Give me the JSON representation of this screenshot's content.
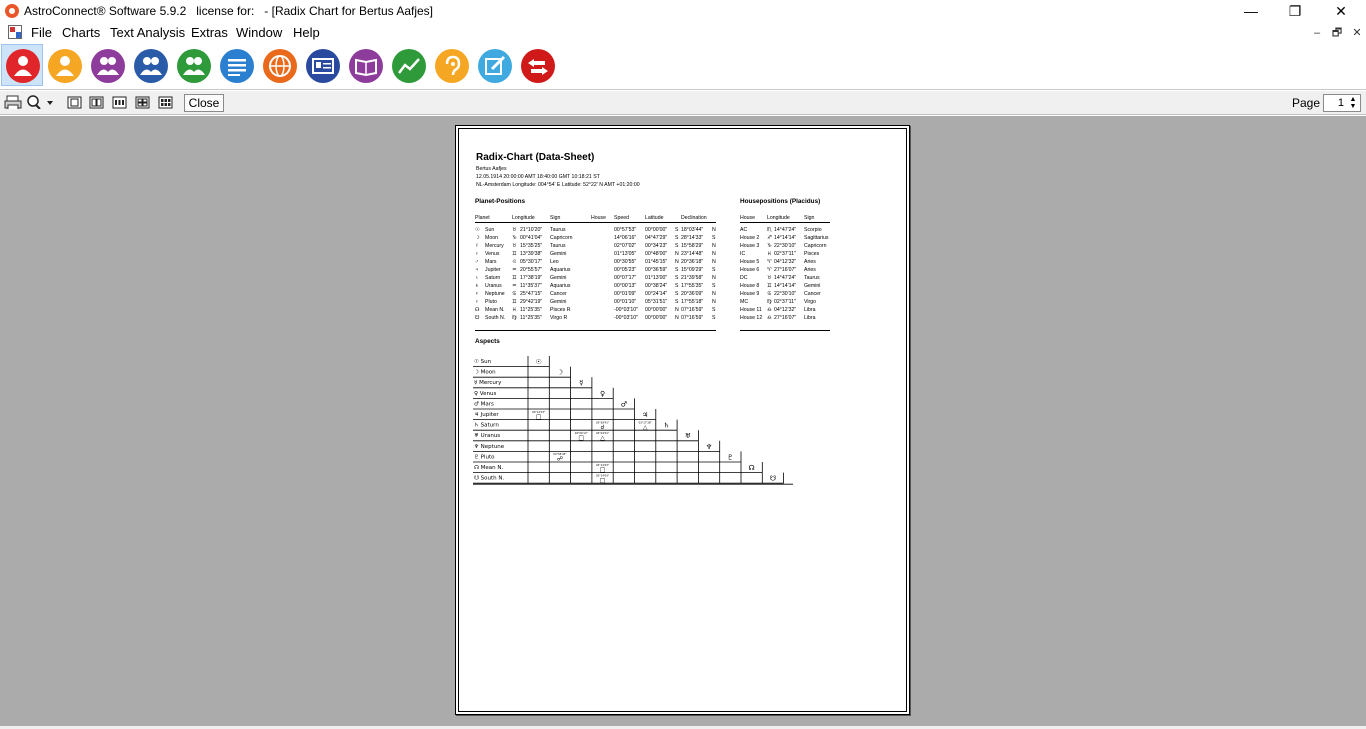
{
  "window": {
    "title": "AstroConnect® Software 5.9.2   license for:   - [Radix Chart for Bertus Aafjes]",
    "controls": {
      "minimize": "—",
      "maximize": "❐",
      "close": "✕"
    }
  },
  "menu": {
    "items": [
      "File",
      "Charts",
      "Text Analysis",
      "Extras",
      "Window",
      "Help"
    ],
    "mdi_controls": [
      "–",
      "🗗",
      "✕"
    ]
  },
  "iconbar": {
    "buttons": [
      {
        "name": "person-icon",
        "color": "#e0262a"
      },
      {
        "name": "person-icon",
        "color": "#f5a623"
      },
      {
        "name": "two-persons-icon",
        "color": "#8e3c9c"
      },
      {
        "name": "two-persons-icon",
        "color": "#2a5ba8"
      },
      {
        "name": "two-persons-icon",
        "color": "#2e9a3a"
      },
      {
        "name": "text-lines-icon",
        "color": "#2b7fd0"
      },
      {
        "name": "globe-icon",
        "color": "#e86a1a"
      },
      {
        "name": "id-card-icon",
        "color": "#2a4aa0"
      },
      {
        "name": "book-icon",
        "color": "#8e3c9c"
      },
      {
        "name": "trend-line-icon",
        "color": "#2e9a3a"
      },
      {
        "name": "ear-icon",
        "color": "#f5a623"
      },
      {
        "name": "edit-icon",
        "color": "#3fa9e0"
      },
      {
        "name": "exit-icon",
        "color": "#d01a1a"
      }
    ]
  },
  "toolbar": {
    "close_label": "Close",
    "page_label": "Page",
    "page_value": "1"
  },
  "sheet": {
    "title": "Radix-Chart (Data-Sheet)",
    "meta": [
      "Bertus Aafjes",
      "12.05.1914 20:00:00 AMT 18:40:00 GMT 10:18:21 ST",
      "NL-Amsterdam Longitude: 004°54' E Latitude: 52°22' N AMT +01:20:00"
    ],
    "planet_section": "Planet-Positions",
    "planet_headers": [
      "Planet",
      "Longitude",
      "Sign",
      "House",
      "Speed",
      "Latitude",
      "Declination"
    ],
    "planets": [
      {
        "g": "☉",
        "name": "Sun",
        "sg": "♉",
        "lon": "21°10'20\"",
        "sign": "Taurus",
        "speed": "00°57'53\"",
        "lat": "00°00'00\"",
        "ld": "S",
        "dec": "18°03'44\"",
        "dd": "N"
      },
      {
        "g": "☽",
        "name": "Moon",
        "sg": "♑",
        "lon": "00°41'04\"",
        "sign": "Capricorn",
        "speed": "14°06'16\"",
        "lat": "04°47'29\"",
        "ld": "S",
        "dec": "28°14'33\"",
        "dd": "S"
      },
      {
        "g": "☿",
        "name": "Mercury",
        "sg": "♉",
        "lon": "15°35'25\"",
        "sign": "Taurus",
        "speed": "02°07'02\"",
        "lat": "00°34'23\"",
        "ld": "S",
        "dec": "15°58'29\"",
        "dd": "N"
      },
      {
        "g": "♀",
        "name": "Venus",
        "sg": "♊",
        "lon": "13°39'38\"",
        "sign": "Gemini",
        "speed": "01°13'05\"",
        "lat": "00°48'00\"",
        "ld": "N",
        "dec": "23°14'48\"",
        "dd": "N"
      },
      {
        "g": "♂",
        "name": "Mars",
        "sg": "♌",
        "lon": "05°30'17\"",
        "sign": "Leo",
        "speed": "00°30'55\"",
        "lat": "01°45'15\"",
        "ld": "N",
        "dec": "20°36'18\"",
        "dd": "N"
      },
      {
        "g": "♃",
        "name": "Jupiter",
        "sg": "♒",
        "lon": "20°55'57\"",
        "sign": "Aquarius",
        "speed": "00°05'23\"",
        "lat": "00°36'59\"",
        "ld": "S",
        "dec": "15°09'29\"",
        "dd": "S"
      },
      {
        "g": "♄",
        "name": "Saturn",
        "sg": "♊",
        "lon": "17°38'19\"",
        "sign": "Gemini",
        "speed": "00°07'17\"",
        "lat": "01°13'00\"",
        "ld": "S",
        "dec": "21°39'58\"",
        "dd": "N"
      },
      {
        "g": "♅",
        "name": "Uranus",
        "sg": "♒",
        "lon": "11°35'37\"",
        "sign": "Aquarius",
        "speed": "00°00'13\"",
        "lat": "00°38'24\"",
        "ld": "S",
        "dec": "17°55'35\"",
        "dd": "S"
      },
      {
        "g": "♆",
        "name": "Neptune",
        "sg": "♋",
        "lon": "25°47'15\"",
        "sign": "Cancer",
        "speed": "00°01'09\"",
        "lat": "00°24'14\"",
        "ld": "S",
        "dec": "20°36'09\"",
        "dd": "N"
      },
      {
        "g": "♇",
        "name": "Pluto",
        "sg": "♊",
        "lon": "29°42'19\"",
        "sign": "Gemini",
        "speed": "00°01'10\"",
        "lat": "05°31'51\"",
        "ld": "S",
        "dec": "17°55'18\"",
        "dd": "N"
      },
      {
        "g": "☊",
        "name": "Mean N.",
        "sg": "♓",
        "lon": "11°25'35\"",
        "sign": "Pisces R",
        "speed": "-00°03'10\"",
        "lat": "00°00'00\"",
        "ld": "N",
        "dec": "07°16'59\"",
        "dd": "S"
      },
      {
        "g": "☋",
        "name": "South N.",
        "sg": "♍",
        "lon": "11°25'35\"",
        "sign": "Virgo R",
        "speed": "-00°03'10\"",
        "lat": "00°00'00\"",
        "ld": "N",
        "dec": "07°16'59\"",
        "dd": "S"
      }
    ],
    "house_section": "Housepositions (Placidus)",
    "house_headers": [
      "House",
      "Longitude",
      "Sign"
    ],
    "houses": [
      {
        "h": "AC",
        "sg": "♏",
        "lon": "14°47'24\"",
        "sign": "Scorpio"
      },
      {
        "h": "House 2",
        "sg": "♐",
        "lon": "14°14'14\"",
        "sign": "Sagittarius"
      },
      {
        "h": "House 3",
        "sg": "♑",
        "lon": "22°30'10\"",
        "sign": "Capricorn"
      },
      {
        "h": "IC",
        "sg": "♓",
        "lon": "02°37'11\"",
        "sign": "Pisces"
      },
      {
        "h": "House 5",
        "sg": "♈",
        "lon": "04°12'32\"",
        "sign": "Aries"
      },
      {
        "h": "House 6",
        "sg": "♈",
        "lon": "27°16'07\"",
        "sign": "Aries"
      },
      {
        "h": "DC",
        "sg": "♉",
        "lon": "14°47'24\"",
        "sign": "Taurus"
      },
      {
        "h": "House 8",
        "sg": "♊",
        "lon": "14°14'14\"",
        "sign": "Gemini"
      },
      {
        "h": "House 9",
        "sg": "♋",
        "lon": "22°30'10\"",
        "sign": "Cancer"
      },
      {
        "h": "MC",
        "sg": "♍",
        "lon": "02°37'11\"",
        "sign": "Virgo"
      },
      {
        "h": "House 11",
        "sg": "♎",
        "lon": "04°12'32\"",
        "sign": "Libra"
      },
      {
        "h": "House 12",
        "sg": "♎",
        "lon": "27°16'07\"",
        "sign": "Libra"
      }
    ],
    "aspects_section": "Aspects",
    "aspect_rows": [
      {
        "g": "☉",
        "name": "Sun"
      },
      {
        "g": "☽",
        "name": "Moon"
      },
      {
        "g": "☿",
        "name": "Mercury"
      },
      {
        "g": "♀",
        "name": "Venus"
      },
      {
        "g": "♂",
        "name": "Mars"
      },
      {
        "g": "♃",
        "name": "Jupiter"
      },
      {
        "g": "♄",
        "name": "Saturn"
      },
      {
        "g": "♅",
        "name": "Uranus"
      },
      {
        "g": "♆",
        "name": "Neptune"
      },
      {
        "g": "♇",
        "name": "Pluto"
      },
      {
        "g": "☊",
        "name": "Mean N."
      },
      {
        "g": "☋",
        "name": "South N."
      }
    ],
    "aspect_cells": [
      {
        "row": 5,
        "col": 0,
        "sym": "□",
        "orb": "00°14'23\""
      },
      {
        "row": 6,
        "col": 3,
        "sym": "☌",
        "orb": "03°58'41\""
      },
      {
        "row": 6,
        "col": 5,
        "sym": "△",
        "orb": "03°17'38\""
      },
      {
        "row": 7,
        "col": 2,
        "sym": "□",
        "orb": "04°00'12\""
      },
      {
        "row": 7,
        "col": 3,
        "sym": "△",
        "orb": "02°04'01\""
      },
      {
        "row": 9,
        "col": 1,
        "sym": "☍",
        "orb": "00°58'45\""
      },
      {
        "row": 10,
        "col": 3,
        "sym": "□",
        "orb": "02°14'03\""
      },
      {
        "row": 11,
        "col": 3,
        "sym": "□",
        "orb": "02°14'03\""
      }
    ]
  }
}
